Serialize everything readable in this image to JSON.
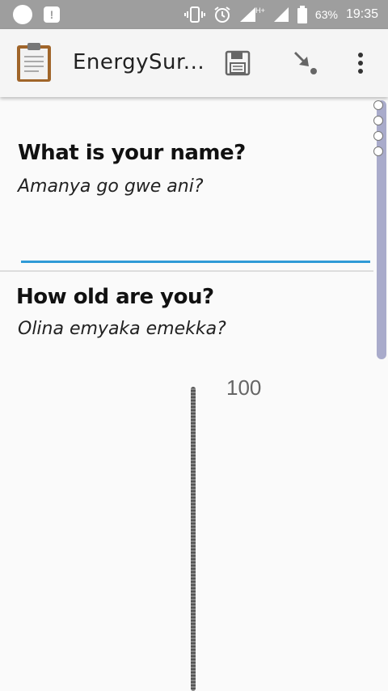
{
  "status_bar": {
    "battery_percent": "63%",
    "time": "19:35",
    "network_type": "H+",
    "icons": [
      "circle-notification-icon",
      "alert-notification-icon",
      "vibrate-icon",
      "alarm-icon",
      "signal-icon",
      "battery-icon"
    ]
  },
  "app_bar": {
    "title": "EnergySur...",
    "icons": {
      "app": "clipboard-icon",
      "save": "save-icon",
      "submit": "submit-arrow-icon",
      "more": "more-vert-icon"
    }
  },
  "questions": [
    {
      "label": "What is your name?",
      "hint": "Amanya go gwe ani?",
      "value": ""
    },
    {
      "label": "How old are you?",
      "hint": "Olina emyaka emekka?",
      "slider_max": "100"
    }
  ],
  "colors": {
    "accent": "#2f9ad6",
    "status_bar": "#9e9e9e",
    "scrollbar": "#a9abcb"
  }
}
